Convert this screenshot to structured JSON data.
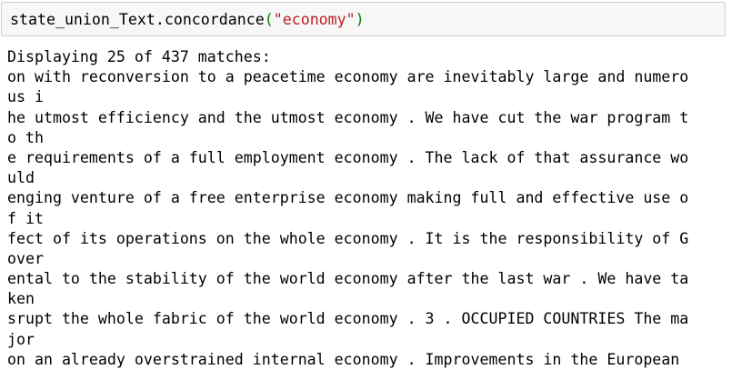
{
  "input_cell": {
    "code_prefix": "state_union_Text.concordance",
    "open_paren": "(",
    "string_arg": "\"economy\"",
    "close_paren": ")"
  },
  "output": {
    "lines": [
      "Displaying 25 of 437 matches:",
      "on with reconversion to a peacetime economy are inevitably large and numero",
      "us i",
      "he utmost efficiency and the utmost economy . We have cut the war program t",
      "o th",
      "e requirements of a full employment economy . The lack of that assurance wo",
      "uld",
      "enging venture of a free enterprise economy making full and effective use o",
      "f it",
      "fect of its operations on the whole economy . It is the responsibility of G",
      "over",
      "ental to the stability of the world economy after the last war . We have ta",
      "ken",
      "srupt the whole fabric of the world economy . 3 . OCCUPIED COUNTRIES The ma",
      "jor",
      "on an already overstrained internal economy . Improvements in the European"
    ]
  },
  "colors": {
    "cell_background": "#f7f7f7",
    "cell_border": "#cfcfcf",
    "string": "#ba2121",
    "paren": "#008000",
    "text": "#000000"
  }
}
